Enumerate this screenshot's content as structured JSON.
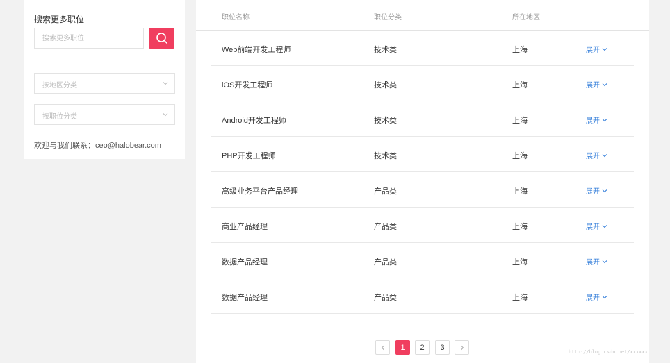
{
  "sidebar": {
    "title": "搜索更多职位",
    "search_placeholder": "搜索更多职位",
    "search_button_icon": "search-icon",
    "region_select_placeholder": "按地区分类",
    "category_select_placeholder": "按职位分类",
    "contact_text": "欢迎与我们联系：ceo@halobear.com"
  },
  "table": {
    "headers": [
      "职位名称",
      "职位分类",
      "所在地区"
    ],
    "expand_label": "展开",
    "rows": [
      {
        "name": "Web前端开发工程师",
        "category": "技术类",
        "location": "上海"
      },
      {
        "name": "iOS开发工程师",
        "category": "技术类",
        "location": "上海"
      },
      {
        "name": "Android开发工程师",
        "category": "技术类",
        "location": "上海"
      },
      {
        "name": "PHP开发工程师",
        "category": "技术类",
        "location": "上海"
      },
      {
        "name": "高级业务平台产品经理",
        "category": "产品类",
        "location": "上海"
      },
      {
        "name": "商业产品经理",
        "category": "产品类",
        "location": "上海"
      },
      {
        "name": "数据产品经理",
        "category": "产品类",
        "location": "上海"
      },
      {
        "name": "数据产品经理",
        "category": "产品类",
        "location": "上海"
      }
    ]
  },
  "pagination": {
    "pages": [
      "1",
      "2",
      "3"
    ],
    "current": "1"
  },
  "watermark": "http://blog.csdn.net/xxxxxx",
  "colors": {
    "accent": "#f03e5f",
    "link": "#2f7bd9",
    "background": "#f2f2f2"
  }
}
